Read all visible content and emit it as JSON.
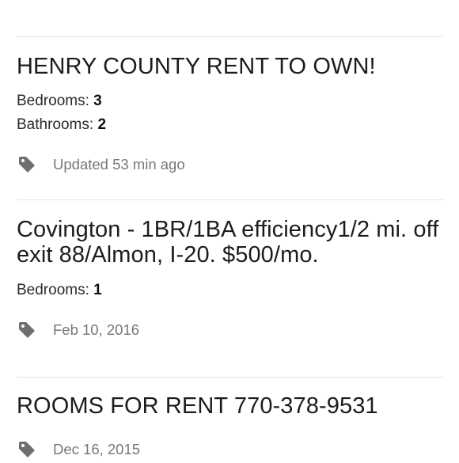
{
  "listings": [
    {
      "title": "HENRY COUNTY RENT TO OWN!",
      "bedrooms_label": "Bedrooms:",
      "bedrooms": "3",
      "bathrooms_label": "Bathrooms:",
      "bathrooms": "2",
      "meta": "Updated 53 min ago",
      "icon": "tag-icon"
    },
    {
      "title": "Covington - 1BR/1BA efficiency1/2 mi. off exit 88/Almon, I-20. $500/mo.",
      "bedrooms_label": "Bedrooms:",
      "bedrooms": "1",
      "meta": "Feb 10, 2016",
      "icon": "tag-icon"
    },
    {
      "title": "ROOMS FOR RENT 770-378-9531",
      "meta": "Dec 16, 2015",
      "icon": "tag-icon"
    }
  ],
  "colors": {
    "text": "#222222",
    "meta": "#777777",
    "icon": "#6f6f6f",
    "divider": "#e3e3e3"
  }
}
